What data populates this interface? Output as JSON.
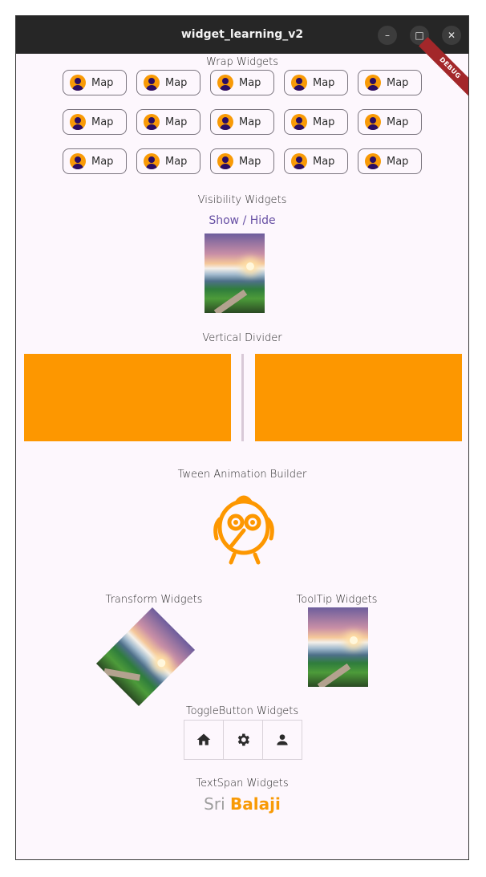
{
  "window": {
    "title": "widget_learning_v2",
    "controls": {
      "minimize": "–",
      "maximize": "□",
      "close": "✕"
    },
    "debug_banner": "DEBUG"
  },
  "wrap": {
    "title": "Wrap Widgets",
    "chips": [
      "Map",
      "Map",
      "Map",
      "Map",
      "Map",
      "Map",
      "Map",
      "Map",
      "Map",
      "Map",
      "Map",
      "Map",
      "Map",
      "Map",
      "Map"
    ],
    "avatar_color": "#f89a06",
    "avatar_icon": "person-icon"
  },
  "visibility": {
    "title": "Visibility Widgets",
    "toggle_label": "Show / Hide",
    "image_icon": "landscape-image"
  },
  "divider": {
    "title": "Vertical Divider",
    "box_color": "#fd9700"
  },
  "tween": {
    "title": "Tween Animation Builder",
    "icon": "bird-icon",
    "icon_color": "#fd9700"
  },
  "transform": {
    "title": "Transform Widgets",
    "rotation_deg": 45
  },
  "tooltip": {
    "title": "ToolTip Widgets"
  },
  "toggle_buttons": {
    "title": "ToggleButton Widgets",
    "icons": [
      "home-icon",
      "settings-icon",
      "person-icon"
    ]
  },
  "textspan": {
    "title": "TextSpan Widgets",
    "first": "Sri ",
    "second": "Balaji",
    "first_color": "#9e9e9e",
    "second_color": "#f89a06"
  }
}
